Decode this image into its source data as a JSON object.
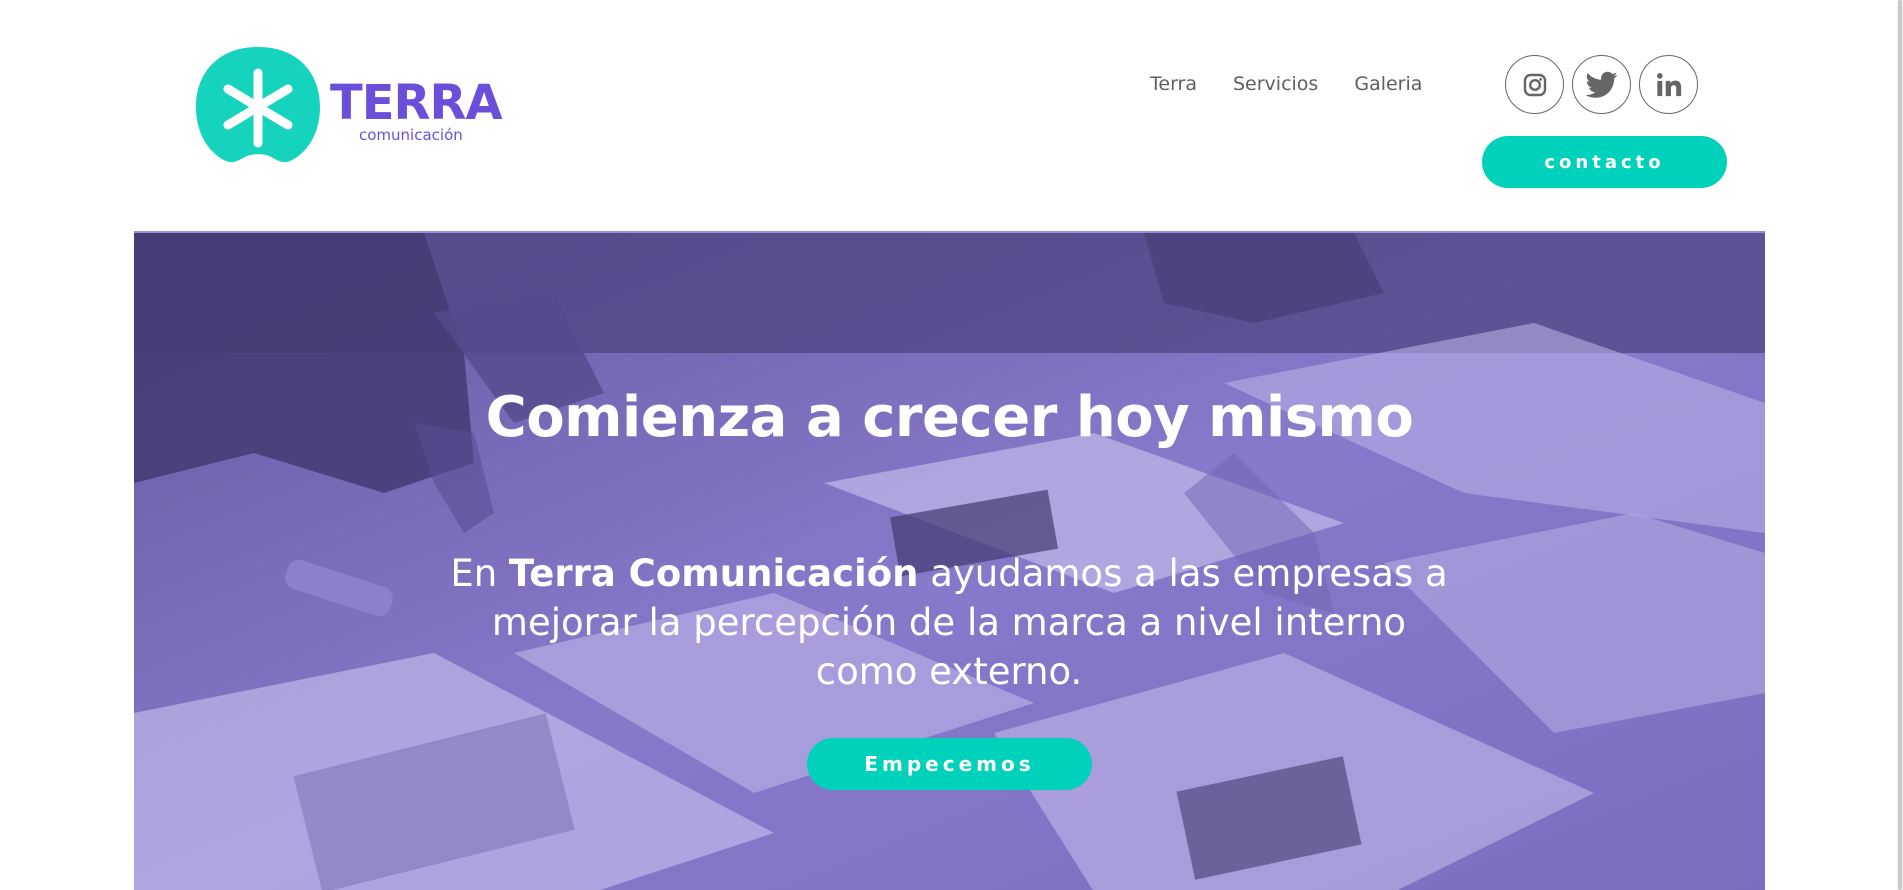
{
  "logo": {
    "wordmark": "TERRA",
    "tagline": "comunicación"
  },
  "nav": {
    "items": [
      {
        "label": "Terra"
      },
      {
        "label": "Servicios"
      },
      {
        "label": "Galeria"
      }
    ]
  },
  "social": {
    "icons": [
      "instagram-icon",
      "twitter-icon",
      "linkedin-icon"
    ]
  },
  "header": {
    "contact_label": "contacto"
  },
  "hero": {
    "title": "Comienza a crecer hoy mismo",
    "text_before": "En ",
    "text_bold": "Terra Comunicación",
    "text_after": " ayudamos a las empresas a mejorar la percepción de la marca a nivel interno como externo.",
    "cta_label": "Empecemos"
  },
  "colors": {
    "accent": "#00d1bb",
    "brand_purple": "#6a4fdb",
    "hero_overlay": "#8f81cf",
    "nav_text": "#5f5f5f"
  }
}
